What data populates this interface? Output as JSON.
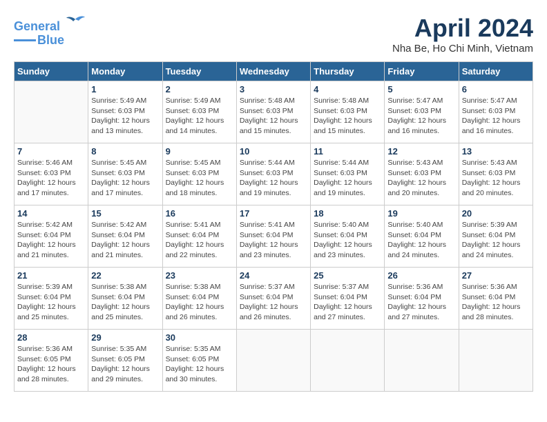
{
  "header": {
    "logo_line1": "General",
    "logo_line2": "Blue",
    "month_title": "April 2024",
    "location": "Nha Be, Ho Chi Minh, Vietnam"
  },
  "weekdays": [
    "Sunday",
    "Monday",
    "Tuesday",
    "Wednesday",
    "Thursday",
    "Friday",
    "Saturday"
  ],
  "weeks": [
    [
      {
        "day": "",
        "info": ""
      },
      {
        "day": "1",
        "info": "Sunrise: 5:49 AM\nSunset: 6:03 PM\nDaylight: 12 hours\nand 13 minutes."
      },
      {
        "day": "2",
        "info": "Sunrise: 5:49 AM\nSunset: 6:03 PM\nDaylight: 12 hours\nand 14 minutes."
      },
      {
        "day": "3",
        "info": "Sunrise: 5:48 AM\nSunset: 6:03 PM\nDaylight: 12 hours\nand 15 minutes."
      },
      {
        "day": "4",
        "info": "Sunrise: 5:48 AM\nSunset: 6:03 PM\nDaylight: 12 hours\nand 15 minutes."
      },
      {
        "day": "5",
        "info": "Sunrise: 5:47 AM\nSunset: 6:03 PM\nDaylight: 12 hours\nand 16 minutes."
      },
      {
        "day": "6",
        "info": "Sunrise: 5:47 AM\nSunset: 6:03 PM\nDaylight: 12 hours\nand 16 minutes."
      }
    ],
    [
      {
        "day": "7",
        "info": "Sunrise: 5:46 AM\nSunset: 6:03 PM\nDaylight: 12 hours\nand 17 minutes."
      },
      {
        "day": "8",
        "info": "Sunrise: 5:45 AM\nSunset: 6:03 PM\nDaylight: 12 hours\nand 17 minutes."
      },
      {
        "day": "9",
        "info": "Sunrise: 5:45 AM\nSunset: 6:03 PM\nDaylight: 12 hours\nand 18 minutes."
      },
      {
        "day": "10",
        "info": "Sunrise: 5:44 AM\nSunset: 6:03 PM\nDaylight: 12 hours\nand 19 minutes."
      },
      {
        "day": "11",
        "info": "Sunrise: 5:44 AM\nSunset: 6:03 PM\nDaylight: 12 hours\nand 19 minutes."
      },
      {
        "day": "12",
        "info": "Sunrise: 5:43 AM\nSunset: 6:03 PM\nDaylight: 12 hours\nand 20 minutes."
      },
      {
        "day": "13",
        "info": "Sunrise: 5:43 AM\nSunset: 6:03 PM\nDaylight: 12 hours\nand 20 minutes."
      }
    ],
    [
      {
        "day": "14",
        "info": "Sunrise: 5:42 AM\nSunset: 6:04 PM\nDaylight: 12 hours\nand 21 minutes."
      },
      {
        "day": "15",
        "info": "Sunrise: 5:42 AM\nSunset: 6:04 PM\nDaylight: 12 hours\nand 21 minutes."
      },
      {
        "day": "16",
        "info": "Sunrise: 5:41 AM\nSunset: 6:04 PM\nDaylight: 12 hours\nand 22 minutes."
      },
      {
        "day": "17",
        "info": "Sunrise: 5:41 AM\nSunset: 6:04 PM\nDaylight: 12 hours\nand 23 minutes."
      },
      {
        "day": "18",
        "info": "Sunrise: 5:40 AM\nSunset: 6:04 PM\nDaylight: 12 hours\nand 23 minutes."
      },
      {
        "day": "19",
        "info": "Sunrise: 5:40 AM\nSunset: 6:04 PM\nDaylight: 12 hours\nand 24 minutes."
      },
      {
        "day": "20",
        "info": "Sunrise: 5:39 AM\nSunset: 6:04 PM\nDaylight: 12 hours\nand 24 minutes."
      }
    ],
    [
      {
        "day": "21",
        "info": "Sunrise: 5:39 AM\nSunset: 6:04 PM\nDaylight: 12 hours\nand 25 minutes."
      },
      {
        "day": "22",
        "info": "Sunrise: 5:38 AM\nSunset: 6:04 PM\nDaylight: 12 hours\nand 25 minutes."
      },
      {
        "day": "23",
        "info": "Sunrise: 5:38 AM\nSunset: 6:04 PM\nDaylight: 12 hours\nand 26 minutes."
      },
      {
        "day": "24",
        "info": "Sunrise: 5:37 AM\nSunset: 6:04 PM\nDaylight: 12 hours\nand 26 minutes."
      },
      {
        "day": "25",
        "info": "Sunrise: 5:37 AM\nSunset: 6:04 PM\nDaylight: 12 hours\nand 27 minutes."
      },
      {
        "day": "26",
        "info": "Sunrise: 5:36 AM\nSunset: 6:04 PM\nDaylight: 12 hours\nand 27 minutes."
      },
      {
        "day": "27",
        "info": "Sunrise: 5:36 AM\nSunset: 6:04 PM\nDaylight: 12 hours\nand 28 minutes."
      }
    ],
    [
      {
        "day": "28",
        "info": "Sunrise: 5:36 AM\nSunset: 6:05 PM\nDaylight: 12 hours\nand 28 minutes."
      },
      {
        "day": "29",
        "info": "Sunrise: 5:35 AM\nSunset: 6:05 PM\nDaylight: 12 hours\nand 29 minutes."
      },
      {
        "day": "30",
        "info": "Sunrise: 5:35 AM\nSunset: 6:05 PM\nDaylight: 12 hours\nand 30 minutes."
      },
      {
        "day": "",
        "info": ""
      },
      {
        "day": "",
        "info": ""
      },
      {
        "day": "",
        "info": ""
      },
      {
        "day": "",
        "info": ""
      }
    ]
  ]
}
